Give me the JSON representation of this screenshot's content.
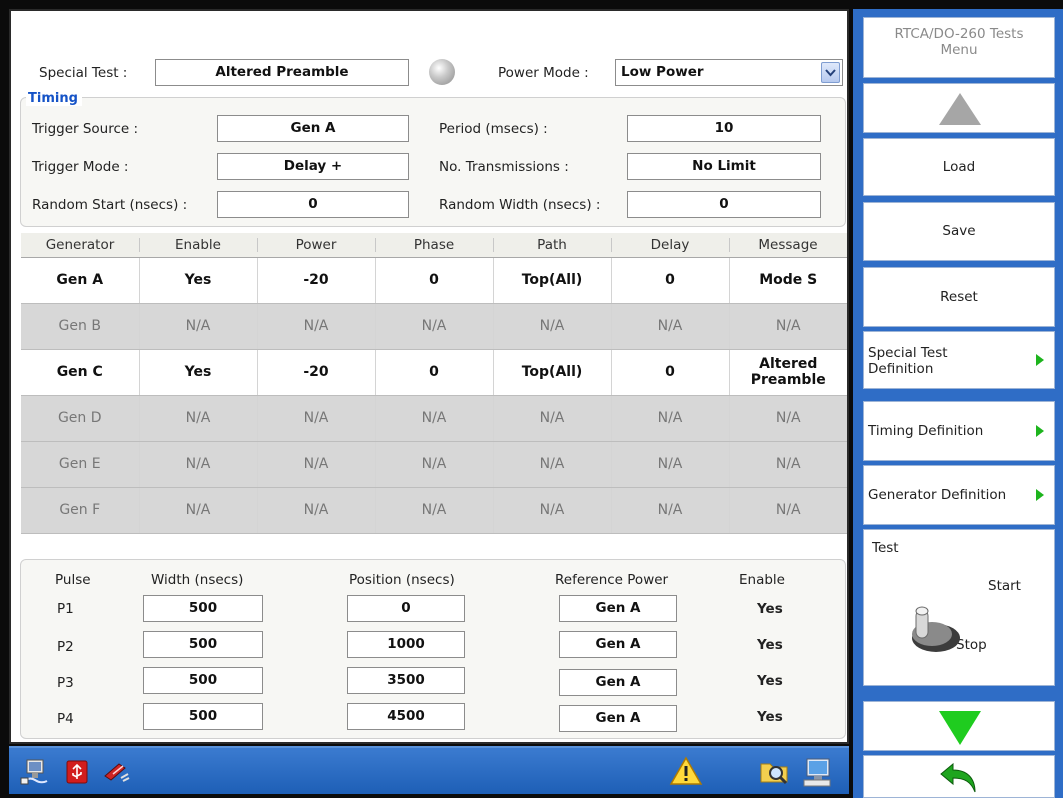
{
  "special_test": {
    "label": "Special Test :",
    "value": "Altered Preamble"
  },
  "power_mode": {
    "label": "Power Mode :",
    "value": "Low Power"
  },
  "timing": {
    "legend": "Timing",
    "trigger_source": {
      "label": "Trigger Source :",
      "value": "Gen A"
    },
    "period": {
      "label": "Period (msecs) :",
      "value": "10"
    },
    "trigger_mode": {
      "label": "Trigger Mode :",
      "value": "Delay +"
    },
    "transmissions": {
      "label": "No. Transmissions :",
      "value": "No Limit"
    },
    "random_start": {
      "label": "Random Start (nsecs) :",
      "value": "0"
    },
    "random_width": {
      "label": "Random Width (nsecs) :",
      "value": "0"
    }
  },
  "generators": {
    "headers": [
      "Generator",
      "Enable",
      "Power",
      "Phase",
      "Path",
      "Delay",
      "Message"
    ],
    "rows": [
      {
        "enabled": true,
        "cells": [
          "Gen A",
          "Yes",
          "-20",
          "0",
          "Top(All)",
          "0",
          "Mode S"
        ]
      },
      {
        "enabled": false,
        "cells": [
          "Gen B",
          "N/A",
          "N/A",
          "N/A",
          "N/A",
          "N/A",
          "N/A"
        ]
      },
      {
        "enabled": true,
        "cells": [
          "Gen C",
          "Yes",
          "-20",
          "0",
          "Top(All)",
          "0",
          "Altered Preamble"
        ]
      },
      {
        "enabled": false,
        "cells": [
          "Gen D",
          "N/A",
          "N/A",
          "N/A",
          "N/A",
          "N/A",
          "N/A"
        ]
      },
      {
        "enabled": false,
        "cells": [
          "Gen E",
          "N/A",
          "N/A",
          "N/A",
          "N/A",
          "N/A",
          "N/A"
        ]
      },
      {
        "enabled": false,
        "cells": [
          "Gen F",
          "N/A",
          "N/A",
          "N/A",
          "N/A",
          "N/A",
          "N/A"
        ]
      }
    ]
  },
  "pulses": {
    "headers": {
      "pulse": "Pulse",
      "width": "Width (nsecs)",
      "position": "Position (nsecs)",
      "reference": "Reference Power",
      "enable": "Enable"
    },
    "rows": [
      {
        "name": "P1",
        "width": "500",
        "position": "0",
        "reference": "Gen A",
        "enable": "Yes"
      },
      {
        "name": "P2",
        "width": "500",
        "position": "1000",
        "reference": "Gen A",
        "enable": "Yes"
      },
      {
        "name": "P3",
        "width": "500",
        "position": "3500",
        "reference": "Gen A",
        "enable": "Yes"
      },
      {
        "name": "P4",
        "width": "500",
        "position": "4500",
        "reference": "Gen A",
        "enable": "Yes"
      }
    ]
  },
  "menu": {
    "title_line1": "RTCA/DO-260 Tests",
    "title_line2": "Menu",
    "load": "Load",
    "save": "Save",
    "reset": "Reset",
    "special_test_def_line1": "Special Test",
    "special_test_def_line2": "Definition",
    "timing_def": "Timing Definition",
    "generator_def": "Generator Definition",
    "test": {
      "label": "Test",
      "start": "Start",
      "stop": "Stop"
    }
  },
  "icons": {
    "taskbar_left": [
      "network-icon",
      "usb-icon",
      "remote-icon"
    ],
    "taskbar_right": [
      "warning-icon",
      "search-folder-icon",
      "monitor-icon"
    ],
    "status_led": "status-led-icon"
  },
  "colors": {
    "accent_blue": "#2f6dc6",
    "legend_blue": "#1553c7",
    "arrow_green": "#1db41d",
    "disabled_row": "#d7d7d7"
  }
}
